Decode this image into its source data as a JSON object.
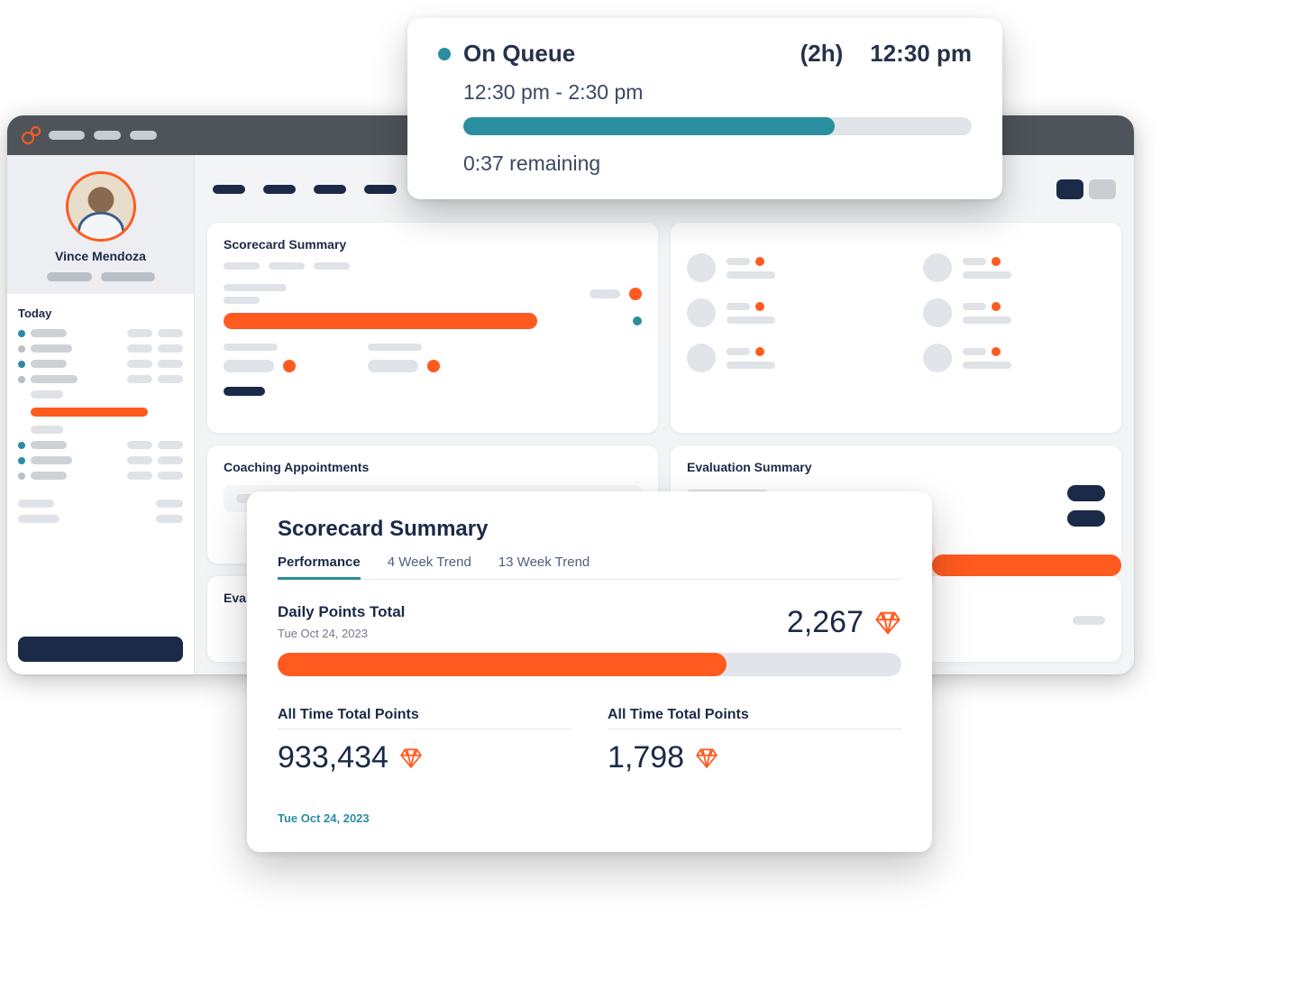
{
  "profile": {
    "name": "Vince Mendoza",
    "today_label": "Today"
  },
  "cards": {
    "scorecard_summary": "Scorecard Summary",
    "coaching": "Coaching Appointments",
    "evaluation": "Evaluation Summary",
    "eval_short": "Eval"
  },
  "queue": {
    "status": "On Queue",
    "duration": "(2h)",
    "now": "12:30 pm",
    "range": "12:30 pm - 2:30 pm",
    "remaining": "0:37 remaining"
  },
  "scorecard": {
    "title": "Scorecard Summary",
    "tabs": {
      "performance": "Performance",
      "trend4": "4 Week Trend",
      "trend13": "13 Week Trend"
    },
    "daily_label": "Daily Points Total",
    "daily_date": "Tue Oct 24, 2023",
    "daily_value": "2,267",
    "col_a_label": "All Time Total Points",
    "col_a_value": "933,434",
    "col_b_label": "All Time Total Points",
    "col_b_value": "1,798",
    "footer_date": "Tue Oct 24, 2023"
  }
}
